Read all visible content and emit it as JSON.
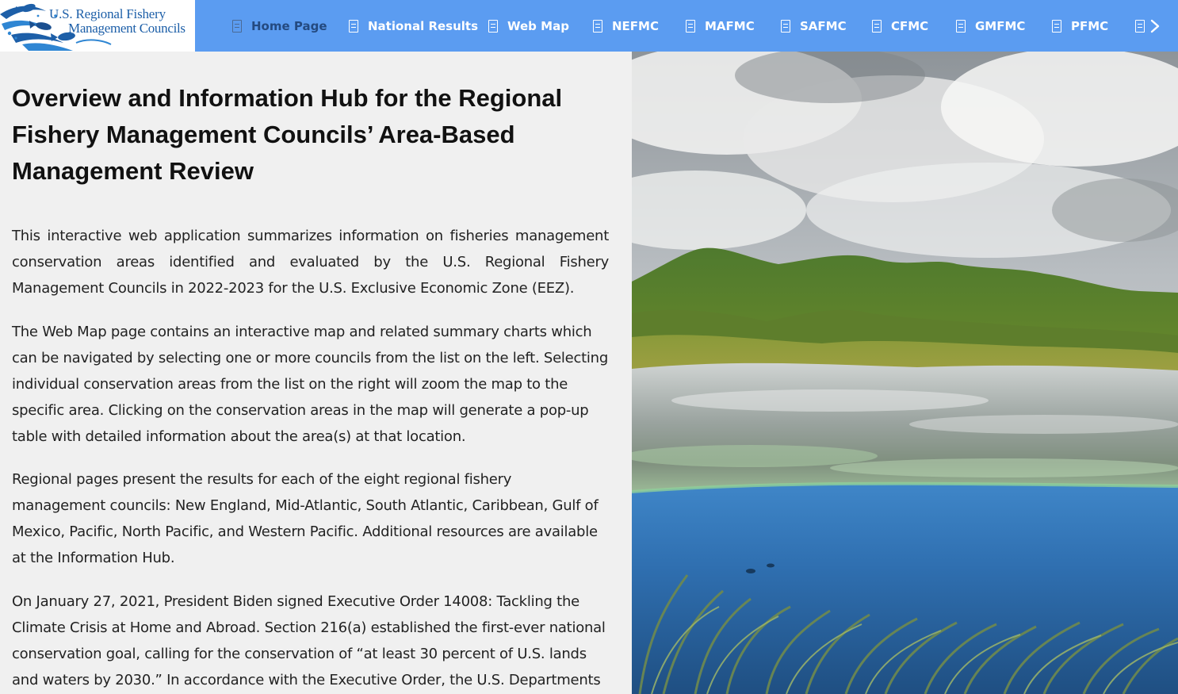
{
  "header": {
    "logo": {
      "line1": "U.S. Regional Fishery",
      "line2": "Management Councils"
    },
    "nav_tabs": [
      {
        "label": "Home Page",
        "active": true
      },
      {
        "label": "National Results",
        "active": false
      },
      {
        "label": "Web Map",
        "active": false
      },
      {
        "label": "NEFMC",
        "active": false
      },
      {
        "label": "MAFMC",
        "active": false
      },
      {
        "label": "SAFMC",
        "active": false
      },
      {
        "label": "CFMC",
        "active": false
      },
      {
        "label": "GMFMC",
        "active": false
      },
      {
        "label": "PFMC",
        "active": false
      }
    ],
    "next_icon": "chevron-right-icon",
    "colors": {
      "bar": "#5b9cf1",
      "active_tab_text": "#244a80",
      "tab_text": "#ffffff"
    }
  },
  "main": {
    "title": "Overview and Information Hub for the Regional Fishery Management Councils’ Area-Based Management Review",
    "paragraphs": [
      "This interactive web application summarizes information on fisheries management conservation areas identified and evaluated by the U.S. Regional Fishery Management Councils in 2022-2023 for the U.S. Exclusive Economic Zone (EEZ).",
      "The Web Map page contains an interactive map and related summary charts which can be navigated by selecting one or more councils from the list on the left. Selecting individual conservation areas from the list on the right will zoom the map to the specific area. Clicking on the conservation areas in the map will generate a pop-up table with detailed information about the area(s) at that location.",
      "Regional pages present the results for each of the eight regional fishery management councils: New England, Mid-Atlantic, South Atlantic, Caribbean, Gulf of Mexico, Pacific, North Pacific, and Western Pacific. Additional resources are available at the Information Hub.",
      "On January 27, 2021, President Biden signed Executive Order 14008: Tackling the Climate Crisis at Home and Abroad. Section 216(a) established the first-ever national conservation goal, calling for the conservation of “at least 30 percent of U.S. lands and waters by 2030.” In accordance with the Executive Order, the U.S. Departments"
    ]
  }
}
